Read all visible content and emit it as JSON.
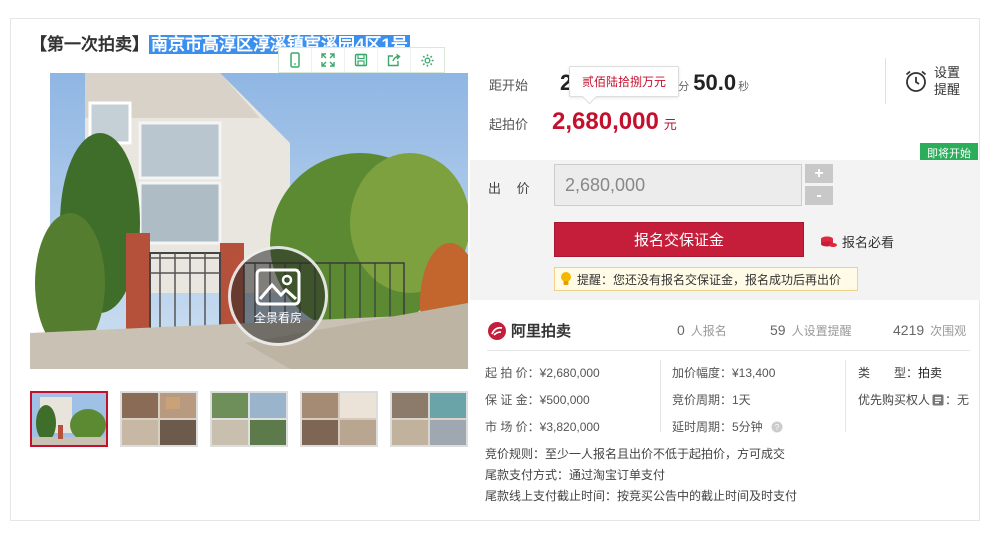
{
  "title": {
    "prefix": "【第一次拍卖】",
    "highlight": "南京市高淳区淳溪镇宦溪园4区1号"
  },
  "image_toolbar": [
    "phone-icon",
    "fullscreen-icon",
    "save-icon",
    "share-icon",
    "settings-icon"
  ],
  "pano": {
    "label": "全景看房"
  },
  "thumbnails": {
    "count": 5,
    "active_index": 0
  },
  "countdown": {
    "label": "距开始",
    "prefix": "2",
    "unit_min": "分",
    "seconds": "50.0",
    "unit_sec": "秒"
  },
  "tooltip": "贰佰陆拾捌万元",
  "remind": {
    "line1": "设置",
    "line2": "提醒"
  },
  "start_price": {
    "label": "起拍价",
    "value": "2,680,000",
    "unit": "元"
  },
  "badge": "即将开始",
  "bid": {
    "label": "出 价",
    "value": "2,680,000",
    "plus": "+",
    "minus": "-"
  },
  "deposit_button": "报名交保证金",
  "must_read": "报名必看",
  "hint": {
    "strong": "提醒：",
    "text": "您还没有报名交保证金，报名成功后再出价"
  },
  "stats": {
    "brand": "阿里拍卖",
    "signup_count": "0",
    "signup_label": "人报名",
    "remind_count": "59",
    "remind_label": "人设置提醒",
    "view_count": "4219",
    "view_label": "次围观"
  },
  "info": {
    "start_price": "起 拍 价：¥2,680,000",
    "deposit": "保 证 金：¥500,000",
    "market_price": "市 场 价：¥3,820,000",
    "increment": "加价幅度：¥13,400",
    "period": "竞价周期：1天",
    "delay": "延时周期：5分钟",
    "type_label": "类　　型：",
    "type_value": "拍卖",
    "priority_label": "优先购买权人",
    "priority_value": "：无"
  },
  "rules": [
    "竞价规则：至少一人报名且出价不低于起拍价，方可成交",
    "尾款支付方式：通过淘宝订单支付",
    "尾款线上支付截止时间：按竞买公告中的截止时间及时支付"
  ],
  "colors": {
    "accent_red": "#c41e3a",
    "highlight_blue": "#3d8fee",
    "badge_green": "#2bad5a"
  }
}
